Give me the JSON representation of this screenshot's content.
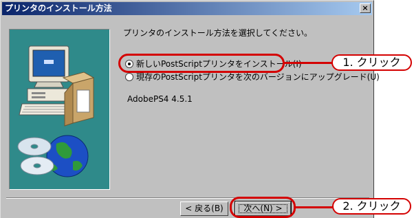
{
  "window": {
    "title": "プリンタのインストール方法",
    "close_symbol": "×"
  },
  "instruction": "プリンタのインストール方法を選択してください。",
  "options": [
    {
      "label": "新しいPostScriptプリンタをインストール(I)",
      "selected": true
    },
    {
      "label": "現存のPostScriptプリンタを次のバージョンにアップグレード(U)",
      "selected": false
    }
  ],
  "version_text": "AdobePS4 4.5.1",
  "buttons": {
    "back": "< 戻る(B)",
    "next": "次へ(N) >"
  },
  "callouts": {
    "step1": "1. クリック",
    "step2": "2. クリック"
  },
  "colors": {
    "highlight": "#d40000",
    "title_start": "#0a246a",
    "title_end": "#a6caf0",
    "illustration_bg": "#2f8a8a"
  },
  "icons": [
    "close-icon",
    "computer-icon",
    "cd-rom-icon",
    "globe-icon",
    "printer-box-icon"
  ]
}
